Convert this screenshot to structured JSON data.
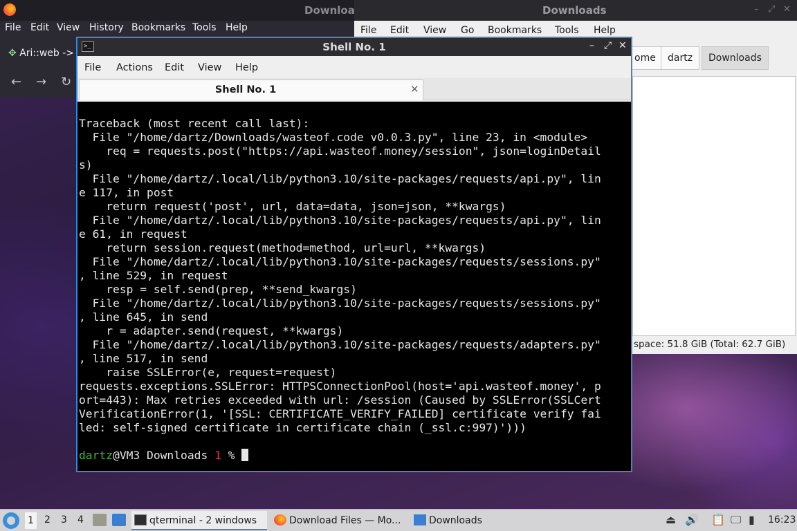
{
  "firefox": {
    "title": "Downloa",
    "menu": [
      "File",
      "Edit",
      "View",
      "History",
      "Bookmarks",
      "Tools",
      "Help"
    ],
    "tab_label": "Ari::web ->"
  },
  "file_manager": {
    "title": "Downloads",
    "menu": [
      "File",
      "Edit",
      "View",
      "Go",
      "Bookmarks",
      "Tools",
      "Help"
    ],
    "breadcrumbs": [
      "ome",
      "dartz",
      "Downloads"
    ],
    "status": "space: 51.8 GiB (Total: 62.7 GiB)"
  },
  "terminal": {
    "title": "Shell No. 1",
    "menu": [
      "File",
      "Actions",
      "Edit",
      "View",
      "Help"
    ],
    "tab_label": "Shell No. 1",
    "output": "Traceback (most recent call last):\n  File \"/home/dartz/Downloads/wasteof.code v0.0.3.py\", line 23, in <module>\n    req = requests.post(\"https://api.wasteof.money/session\", json=loginDetail\ns)\n  File \"/home/dartz/.local/lib/python3.10/site-packages/requests/api.py\", lin\ne 117, in post\n    return request('post', url, data=data, json=json, **kwargs)\n  File \"/home/dartz/.local/lib/python3.10/site-packages/requests/api.py\", lin\ne 61, in request\n    return session.request(method=method, url=url, **kwargs)\n  File \"/home/dartz/.local/lib/python3.10/site-packages/requests/sessions.py\"\n, line 529, in request\n    resp = self.send(prep, **send_kwargs)\n  File \"/home/dartz/.local/lib/python3.10/site-packages/requests/sessions.py\"\n, line 645, in send\n    r = adapter.send(request, **kwargs)\n  File \"/home/dartz/.local/lib/python3.10/site-packages/requests/adapters.py\"\n, line 517, in send\n    raise SSLError(e, request=request)\nrequests.exceptions.SSLError: HTTPSConnectionPool(host='api.wasteof.money', p\nort=443): Max retries exceeded with url: /session (Caused by SSLError(SSLCert\nVerificationError(1, '[SSL: CERTIFICATE_VERIFY_FAILED] certificate verify fai\nled: self-signed certificate in certificate chain (_ssl.c:997)')))",
    "prompt": {
      "user": "dartz",
      "host_dir": "@VM3 Downloads ",
      "status_num": "1",
      "symbol": " % "
    }
  },
  "taskbar": {
    "desktops": [
      "1",
      "2",
      "3",
      "4"
    ],
    "tasks": [
      {
        "label": "qterminal - 2 windows",
        "icon": "terminal-icon"
      },
      {
        "label": "Download Files — Mo...",
        "icon": "firefox-icon"
      },
      {
        "label": "Downloads",
        "icon": "folder-icon"
      }
    ],
    "clock": "16:23"
  },
  "colors": {
    "accent": "#3a87d8",
    "prompt_user": "#3fb838",
    "prompt_status": "#d13b3b",
    "terminal_bg": "#000000"
  }
}
